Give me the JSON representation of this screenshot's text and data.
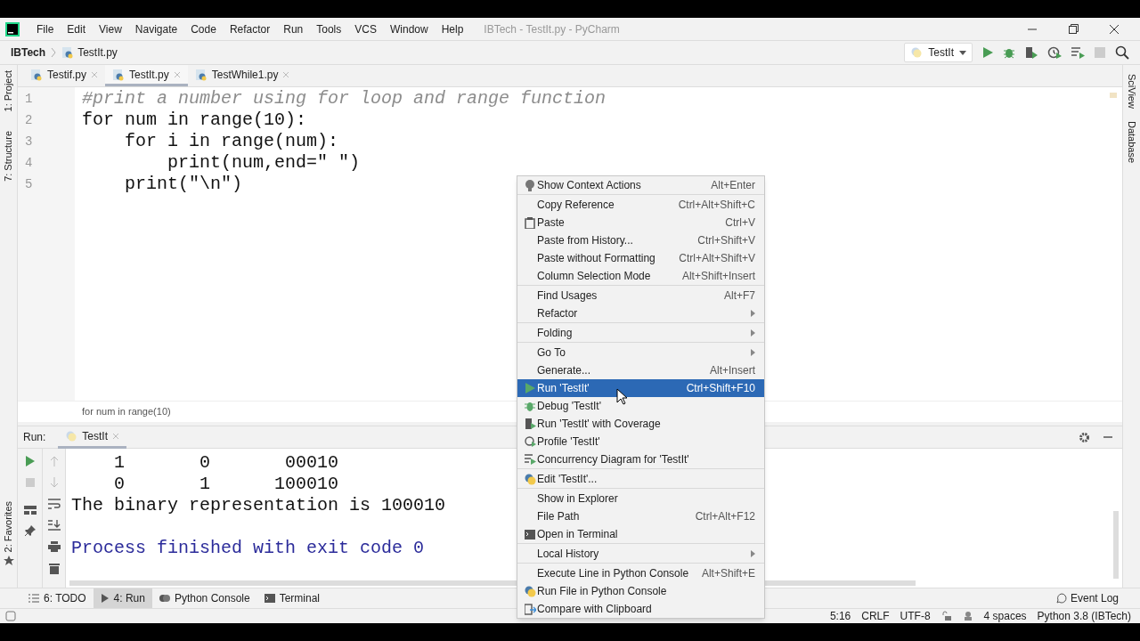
{
  "menu_bar": {
    "items": [
      "File",
      "Edit",
      "View",
      "Navigate",
      "Code",
      "Refactor",
      "Run",
      "Tools",
      "VCS",
      "Window",
      "Help"
    ],
    "title": "IBTech - TestIt.py - PyCharm"
  },
  "navigation_bar": {
    "project": "IBTech",
    "file": "TestIt.py",
    "run_config": "TestIt"
  },
  "left_stripe": [
    "1: Project",
    "7: Structure"
  ],
  "right_stripe": [
    "SciView",
    "Database"
  ],
  "editor_tabs": [
    {
      "label": "Testif.py",
      "selected": false
    },
    {
      "label": "TestIt.py",
      "selected": true
    },
    {
      "label": "TestWhile1.py",
      "selected": false
    }
  ],
  "code_lines": [
    {
      "number": "1",
      "kind": "comment",
      "text": "#print a number using for loop and range function"
    },
    {
      "number": "2",
      "kind": "code",
      "text": "for num in range(10):"
    },
    {
      "number": "3",
      "kind": "code",
      "text": "    for i in range(num):"
    },
    {
      "number": "4",
      "kind": "code",
      "text": "        print(num,end=\" \")"
    },
    {
      "number": "5",
      "kind": "code",
      "text": "    print(\"\\n\")"
    }
  ],
  "breadcrumb": "for num in range(10)",
  "run_panel": {
    "label": "Run:",
    "tab": "TestIt",
    "output": [
      {
        "kind": "stdout",
        "text": "    1       0       00010"
      },
      {
        "kind": "stdout",
        "text": "    0       1      100010"
      },
      {
        "kind": "stdout",
        "text": "The binary representation is 100010"
      },
      {
        "kind": "blank"
      },
      {
        "kind": "system",
        "text": "Process finished with exit code 0"
      }
    ]
  },
  "favorites": "2: Favorites",
  "tool_windows": [
    {
      "label": "6: TODO",
      "selected": false
    },
    {
      "label": "4: Run",
      "selected": true
    },
    {
      "label": "Python Console",
      "selected": false
    },
    {
      "label": "Terminal",
      "selected": false
    }
  ],
  "event_log": "Event Log",
  "status_bar": {
    "position": "5:16",
    "line_separator": "CRLF",
    "encoding": "UTF-8",
    "indent": "4 spaces",
    "interpreter": "Python 3.8 (IBTech)"
  },
  "context_menu": {
    "groups": [
      [
        {
          "label": "Show Context Actions",
          "shortcut": "Alt+Enter",
          "submenu": false,
          "selected": false
        }
      ],
      [
        {
          "label": "Copy Reference",
          "shortcut": "Ctrl+Alt+Shift+C",
          "submenu": false,
          "selected": false
        },
        {
          "label": "Paste",
          "shortcut": "Ctrl+V",
          "submenu": false,
          "selected": false
        },
        {
          "label": "Paste from History...",
          "shortcut": "Ctrl+Shift+V",
          "submenu": false,
          "selected": false
        },
        {
          "label": "Paste without Formatting",
          "shortcut": "Ctrl+Alt+Shift+V",
          "submenu": false,
          "selected": false
        },
        {
          "label": "Column Selection Mode",
          "shortcut": "Alt+Shift+Insert",
          "submenu": false,
          "selected": false
        }
      ],
      [
        {
          "label": "Find Usages",
          "shortcut": "Alt+F7",
          "submenu": false,
          "selected": false
        },
        {
          "label": "Refactor",
          "submenu": true,
          "selected": false
        }
      ],
      [
        {
          "label": "Folding",
          "submenu": true,
          "selected": false
        }
      ],
      [
        {
          "label": "Go To",
          "submenu": true,
          "selected": false
        },
        {
          "label": "Generate...",
          "shortcut": "Alt+Insert",
          "submenu": false,
          "selected": false
        },
        {
          "label": "Run 'TestIt'",
          "shortcut": "Ctrl+Shift+F10",
          "submenu": false,
          "selected": true
        },
        {
          "label": "Debug 'TestIt'",
          "submenu": false,
          "selected": false
        },
        {
          "label": "Run 'TestIt' with Coverage",
          "submenu": false,
          "selected": false
        },
        {
          "label": "Profile 'TestIt'",
          "submenu": false,
          "selected": false
        },
        {
          "label": "Concurrency Diagram for 'TestIt'",
          "submenu": false,
          "selected": false
        }
      ],
      [
        {
          "label": "Edit 'TestIt'...",
          "submenu": false,
          "selected": false
        }
      ],
      [
        {
          "label": "Show in Explorer",
          "submenu": false,
          "selected": false
        },
        {
          "label": "File Path",
          "shortcut": "Ctrl+Alt+F12",
          "submenu": false,
          "selected": false
        },
        {
          "label": "Open in Terminal",
          "submenu": false,
          "selected": false
        }
      ],
      [
        {
          "label": "Local History",
          "submenu": true,
          "selected": false
        }
      ],
      [
        {
          "label": "Execute Line in Python Console",
          "shortcut": "Alt+Shift+E",
          "submenu": false,
          "selected": false
        },
        {
          "label": "Run File in Python Console",
          "submenu": false,
          "selected": false
        },
        {
          "label": "Compare with Clipboard",
          "submenu": false,
          "selected": false
        }
      ]
    ]
  }
}
